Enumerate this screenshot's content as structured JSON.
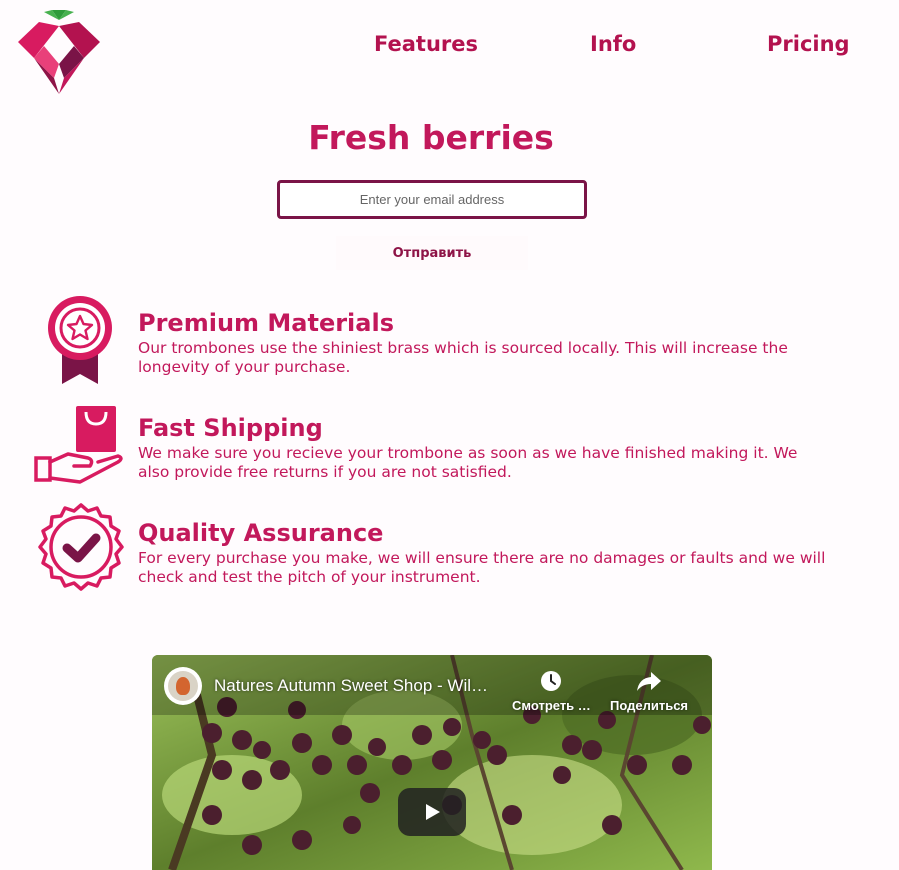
{
  "nav": {
    "features": "Features",
    "info": "Info",
    "pricing": "Pricing"
  },
  "hero": {
    "title": "Fresh berries",
    "email_placeholder": "Enter your email address",
    "email_value": "",
    "submit_label": "Отправить"
  },
  "features": [
    {
      "icon": "award-ribbon-icon",
      "title": "Premium Materials",
      "text": "Our trombones use the shiniest brass which is sourced locally. This will increase the longevity of your purchase."
    },
    {
      "icon": "shopping-bag-hand-icon",
      "title": "Fast Shipping",
      "text": "We make sure you recieve your trombone as soon as we have finished making it. We also provide free returns if you are not satisfied."
    },
    {
      "icon": "checkmark-seal-icon",
      "title": "Quality Assurance",
      "text": "For every purchase you make, we will ensure there are no damages or faults and we will check and test the pitch of your instrument."
    }
  ],
  "video": {
    "title": "Natures Autumn Sweet Shop - Wil…",
    "watch_later": "Смотреть …",
    "share": "Поделиться"
  },
  "colors": {
    "accent": "#c2185b",
    "dark_accent": "#7a1447",
    "background": "#fffcfe"
  }
}
